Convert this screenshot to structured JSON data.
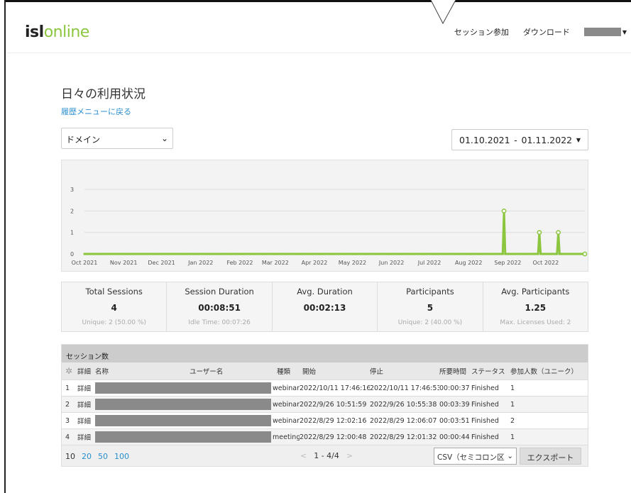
{
  "header": {
    "logo_isl": "isl",
    "logo_online": "online",
    "nav_join": "セッション参加",
    "nav_download": "ダウンロード"
  },
  "page": {
    "title": "日々の利用状況",
    "back_link": "履歴メニューに戻る"
  },
  "filters": {
    "domain_select": "ドメイン",
    "date_from": "01.10.2021",
    "date_sep": "-",
    "date_to": "01.11.2022"
  },
  "chart_data": {
    "type": "line",
    "y_ticks": [
      "0",
      "1",
      "2",
      "3"
    ],
    "ylim": [
      0,
      3
    ],
    "x_ticks": [
      "Oct 2021",
      "Nov 2021",
      "Dec 2021",
      "Jan 2022",
      "Feb 2022",
      "Mar 2022",
      "Apr 2022",
      "May 2022",
      "Jun 2022",
      "Jul 2022",
      "Aug 2022",
      "Sep 2022",
      "Oct 2022"
    ],
    "xlim": [
      "2021-10-01",
      "2022-11-01"
    ],
    "peaks": [
      {
        "date": "2022-08-29",
        "value": 2
      },
      {
        "date": "2022-09-26",
        "value": 1
      },
      {
        "date": "2022-10-11",
        "value": 1
      }
    ],
    "color": "#8cc63f",
    "grid": true
  },
  "stats": [
    {
      "label": "Total Sessions",
      "value": "4",
      "sub": "Unique: 2 (50.00 %)"
    },
    {
      "label": "Session Duration",
      "value": "00:08:51",
      "sub": "Idle Time: 00:07:26"
    },
    {
      "label": "Avg. Duration",
      "value": "00:02:13",
      "sub": ""
    },
    {
      "label": "Participants",
      "value": "5",
      "sub": "Unique: 2 (40.00 %)"
    },
    {
      "label": "Avg. Participants",
      "value": "1.25",
      "sub": "Max. Licenses Used: 2"
    }
  ],
  "table": {
    "title": "セッション数",
    "headers": {
      "detail": "詳細",
      "name": "名称",
      "user": "ユーザー名",
      "type": "種類",
      "start": "開始",
      "stop": "停止",
      "duration": "所要時間",
      "status": "ステータス",
      "participants": "参加人数（ユニーク）"
    },
    "rows": [
      {
        "idx": "1",
        "detail": "詳細",
        "type": "webinar",
        "start": "2022/10/11 17:46:16",
        "stop": "2022/10/11 17:46:53",
        "duration": "00:00:37",
        "status": "Finished",
        "participants": "1"
      },
      {
        "idx": "2",
        "detail": "詳細",
        "type": "webinar",
        "start": "2022/9/26 10:51:59",
        "stop": "2022/9/26 10:55:38",
        "duration": "00:03:39",
        "status": "Finished",
        "participants": "1"
      },
      {
        "idx": "3",
        "detail": "詳細",
        "type": "webinar",
        "start": "2022/8/29 12:02:16",
        "stop": "2022/8/29 12:06:07",
        "duration": "00:03:51",
        "status": "Finished",
        "participants": "2"
      },
      {
        "idx": "4",
        "detail": "詳細",
        "type": "meeting",
        "start": "2022/8/29 12:00:48",
        "stop": "2022/8/29 12:01:32",
        "duration": "00:00:44",
        "status": "Finished",
        "participants": "1"
      }
    ]
  },
  "footer": {
    "page_sizes": [
      "10",
      "20",
      "50",
      "100"
    ],
    "prev": "<",
    "range": "1 - 4/4",
    "next": ">",
    "format_select": "CSV（セミコロン区",
    "export_label": "エクスポート"
  }
}
